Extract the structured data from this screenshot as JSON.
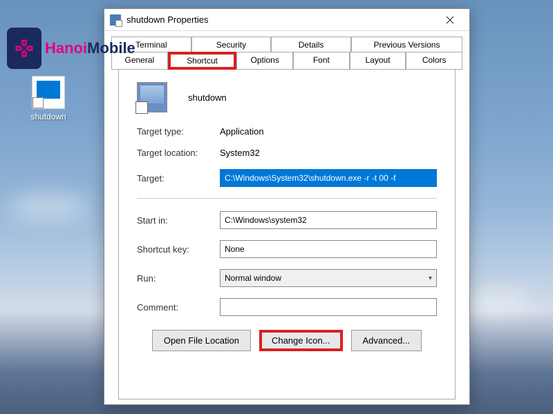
{
  "watermark": {
    "text1": "Hanoi",
    "text2": "Mobile"
  },
  "desktop": {
    "shortcut_label": "shutdown"
  },
  "dialog": {
    "title": "shutdown Properties",
    "tabs_row1": [
      "Terminal",
      "Security",
      "Details",
      "Previous Versions"
    ],
    "tabs_row2": [
      "General",
      "Shortcut",
      "Options",
      "Font",
      "Layout",
      "Colors"
    ],
    "active_tab": "Shortcut",
    "shortcut_name": "shutdown",
    "fields": {
      "target_type_label": "Target type:",
      "target_type_value": "Application",
      "target_location_label": "Target location:",
      "target_location_value": "System32",
      "target_label": "Target:",
      "target_value": "C:\\Windows\\System32\\shutdown.exe -r -t 00 -f",
      "start_in_label": "Start in:",
      "start_in_value": "C:\\Windows\\system32",
      "shortcut_key_label": "Shortcut key:",
      "shortcut_key_value": "None",
      "run_label": "Run:",
      "run_value": "Normal window",
      "comment_label": "Comment:",
      "comment_value": ""
    },
    "buttons": {
      "open_location": "Open File Location",
      "change_icon": "Change Icon...",
      "advanced": "Advanced..."
    }
  }
}
